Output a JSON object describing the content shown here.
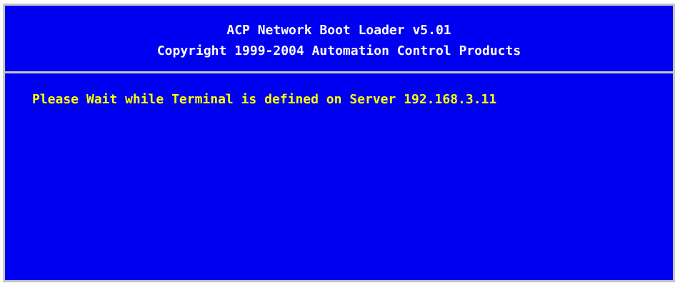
{
  "header": {
    "title": "ACP Network Boot Loader v5.01",
    "copyright": "Copyright 1999-2004 Automation Control Products"
  },
  "body": {
    "message": "Please Wait while Terminal is defined on Server 192.168.3.11"
  },
  "colors": {
    "background": "#0000f0",
    "border": "#c6c6c6",
    "header_text": "#ffffff",
    "message_text": "#ffff00"
  }
}
